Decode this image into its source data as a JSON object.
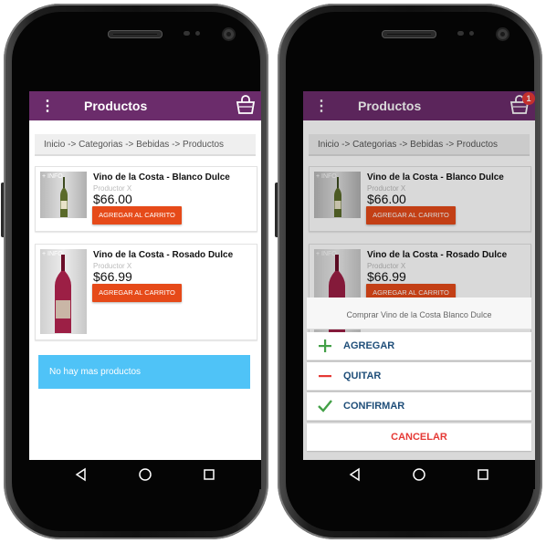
{
  "left": {
    "appbar": {
      "title": "Productos"
    },
    "breadcrumb": "Inicio -> Categorias -> Bebidas -> Productos",
    "products": [
      {
        "info": "+ INFO",
        "name": "Vino de la Costa - Blanco Dulce",
        "producer": "Productor X",
        "price": "$66.00",
        "button": "AGREGAR AL CARRITO"
      },
      {
        "info": "+ INFO",
        "name": "Vino de la Costa - Rosado Dulce",
        "producer": "Productor X",
        "price": "$66.99",
        "button": "AGREGAR AL CARRITO"
      }
    ],
    "no_more": "No hay mas productos"
  },
  "right": {
    "appbar": {
      "title": "Productos",
      "cart_badge": "1"
    },
    "breadcrumb": "Inicio -> Categorias -> Bebidas -> Productos",
    "products": [
      {
        "info": "+ INFO",
        "name": "Vino de la Costa - Blanco Dulce",
        "producer": "Productor X",
        "price": "$66.00",
        "button": "AGREGAR AL CARRITO"
      },
      {
        "info": "+ INFO",
        "name": "Vino de la Costa - Rosado Dulce",
        "producer": "Productor X",
        "price": "$66.99",
        "button": "AGREGAR AL CARRITO"
      }
    ],
    "sheet": {
      "title": "Comprar Vino de la Costa Blanco Dulce",
      "options": [
        {
          "label": "AGREGAR",
          "icon": "plus-icon"
        },
        {
          "label": "QUITAR",
          "icon": "minus-icon"
        },
        {
          "label": "CONFIRMAR",
          "icon": "check-icon"
        }
      ],
      "cancel": "CANCELAR"
    }
  },
  "colors": {
    "appbar": "#6b2c6b",
    "accent_button": "#e64a19",
    "info_banner": "#4fc3f7",
    "badge": "#e53935",
    "option_text": "#1f4e79"
  }
}
